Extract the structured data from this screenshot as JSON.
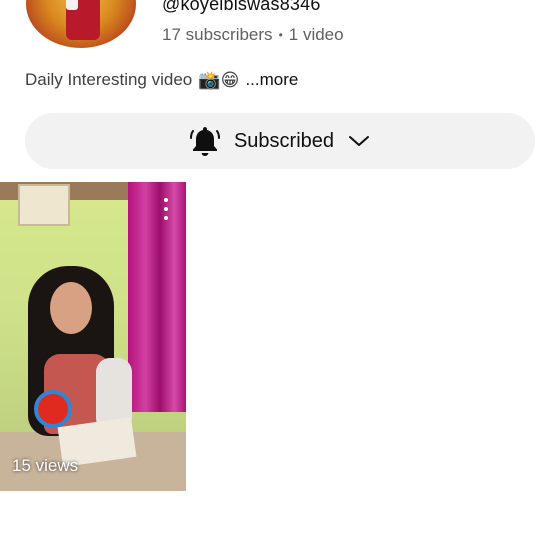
{
  "channel": {
    "handle": "@koyelbiswas8346",
    "subscribers": "17 subscribers",
    "separator": "•",
    "video_count": "1 video",
    "description": "Daily Interesting video",
    "description_emojis": "📸😁",
    "more_label": "...more"
  },
  "subscribe_button": {
    "label": "Subscribed",
    "bell_icon": "bell-icon",
    "chevron_icon": "chevron-down-icon"
  },
  "videos": [
    {
      "views": "15 views",
      "menu_icon": "more-vert-icon"
    }
  ],
  "colors": {
    "button_bg": "#f2f2f2",
    "secondary_text": "#606060",
    "primary_text": "#0f0f0f"
  }
}
